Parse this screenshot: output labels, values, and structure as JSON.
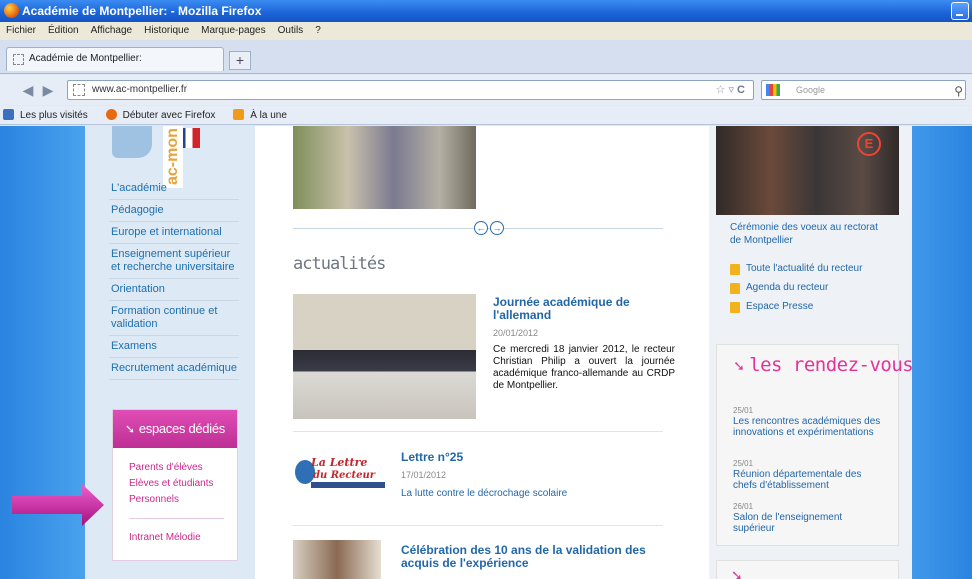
{
  "window": {
    "title": "Académie de Montpellier: - Mozilla Firefox"
  },
  "menubar": [
    "Fichier",
    "Édition",
    "Affichage",
    "Historique",
    "Marque-pages",
    "Outils",
    "?"
  ],
  "tab": {
    "title": "Académie de Montpellier:",
    "new_tab": "+"
  },
  "navbar": {
    "url": "www.ac-montpellier.fr",
    "search_placeholder": "Google"
  },
  "bookmarks": [
    "Les plus visités",
    "Débuter avec Firefox",
    "À la une"
  ],
  "sidebar": {
    "brand": "ac-mon",
    "nav": [
      "L'académie",
      "Pédagogie",
      "Europe et international",
      "Enseignement supérieur et recherche universitaire",
      "Orientation",
      "Formation continue et validation",
      "Examens",
      "Recrutement académique"
    ],
    "espaces": {
      "title": "espaces dédiés",
      "links": [
        "Parents d'élèves",
        "Elèves et étudiants",
        "Personnels",
        "Intranet Mélodie"
      ]
    }
  },
  "main": {
    "section_title": "actualités",
    "slider_prev": "←",
    "slider_next": "→",
    "news": [
      {
        "title": "Journée académique de l'allemand",
        "date": "20/01/2012",
        "text": "Ce mercredi 18 janvier 2012, le recteur Christian Philip a ouvert la journée académique franco-allemande au CRDP de Montpellier."
      },
      {
        "title": "Lettre n°25",
        "date": "17/01/2012",
        "text": "La lutte contre le décrochage scolaire",
        "image_text": "La Lettre du Recteur"
      },
      {
        "title": "Célébration des 10 ans de la validation des acquis de l'expérience"
      }
    ]
  },
  "right": {
    "caption": "Cérémonie des voeux au rectorat de Montpellier",
    "links": [
      "Toute l'actualité du recteur",
      "Agenda du recteur",
      "Espace Presse"
    ],
    "rendezvous": {
      "title": "les rendez-vous",
      "items": [
        {
          "date": "25/01",
          "title": "Les rencontres académiques des innovations et expérimentations"
        },
        {
          "date": "25/01",
          "title": "Réunion départementale des chefs d'établissement"
        },
        {
          "date": "26/01",
          "title": "Salon de l'enseignement supérieur"
        }
      ]
    }
  },
  "colors": {
    "accent_pink": "#e0349b",
    "link_blue": "#2267a8",
    "brand_orange": "#e8a23b"
  }
}
